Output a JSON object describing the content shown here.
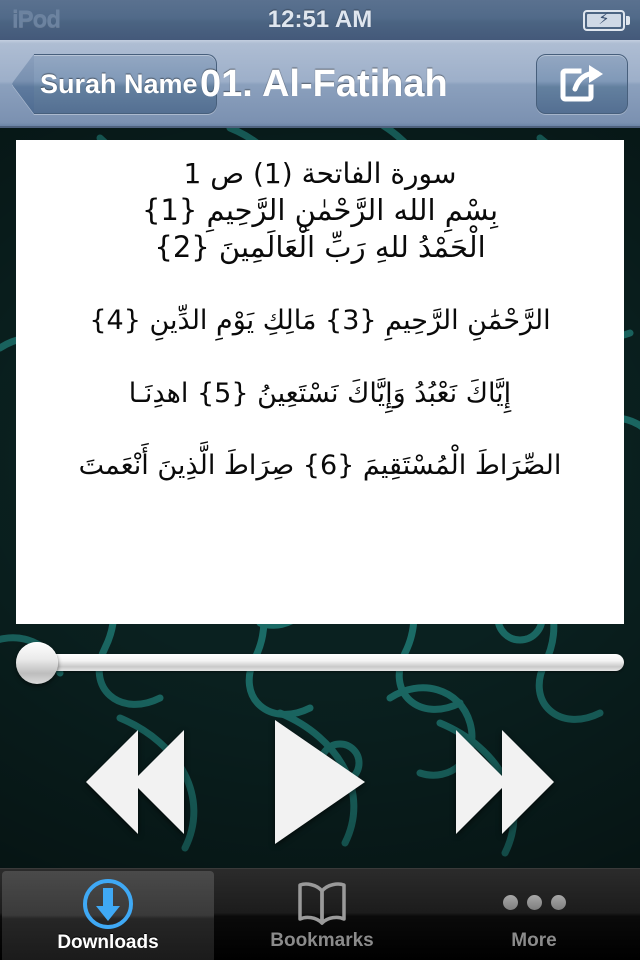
{
  "status_bar": {
    "carrier": "iPod",
    "time": "12:51 AM",
    "battery_icon": "battery-charging-icon",
    "battery_bolt": "⚡"
  },
  "nav_bar": {
    "back_label": "Surah Name",
    "title": "01. Al-Fatihah",
    "share_icon": "share-icon"
  },
  "content": {
    "lines": [
      {
        "id": "header",
        "text": "سورة الفاتحة (1) ص 1"
      },
      {
        "id": "ayah-1",
        "text": "بِسْمِ الله الرَّحْمٰنِ الرَّحِيمِ {1}"
      },
      {
        "id": "ayah-2",
        "text": "الْحَمْدُ للهِ رَبِّ الْعَالَمِينَ {2}"
      },
      {
        "id": "ayah-3-4",
        "text": "الرَّحْمَٰنِ الرَّحِيمِ {3} مَالِكِ يَوْمِ الدِّينِ {4}"
      },
      {
        "id": "ayah-5",
        "text": "إِيَّاكَ نَعْبُدُ وَإِيَّاكَ نَسْتَعِينُ {5} اهدِنَـا"
      },
      {
        "id": "ayah-6-7",
        "text": "الصِّرَاطَ الْمُسْتَقِيمَ {6} صِرَاطَ الَّذِينَ أَنْعَمتَ"
      }
    ]
  },
  "player": {
    "progress_percent": 0,
    "slider_name": "playback-position-slider",
    "previous_label": "Previous",
    "play_label": "Play",
    "next_label": "Next"
  },
  "tab_bar": {
    "tabs": [
      {
        "label": "Downloads",
        "icon": "download-circle-icon",
        "active": true
      },
      {
        "label": "Bookmarks",
        "icon": "open-book-icon",
        "active": false
      },
      {
        "label": "More",
        "icon": "three-dots-icon",
        "active": false
      }
    ]
  },
  "colors": {
    "nav_blue": "#8ba0bd",
    "background_teal": "#0a2120",
    "pattern_teal": "#1c6f69",
    "accent_blue": "#3fa9f5",
    "panel_white": "#ffffff",
    "tab_active_text": "#ffffff",
    "tab_inactive_text": "#8b8b8b"
  }
}
